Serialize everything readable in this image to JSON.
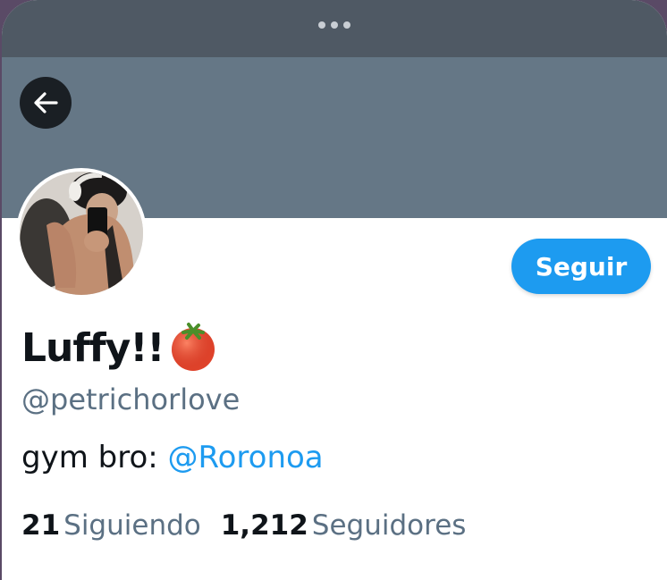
{
  "header": {
    "menu_icon": "more-dots-icon",
    "back_icon": "arrow-left-icon"
  },
  "colors": {
    "top_bar": "#4f5964",
    "banner": "#657786",
    "accent": "#1d9bf0",
    "text_primary": "#0f1419",
    "text_secondary": "#5b7083"
  },
  "profile": {
    "avatar_icon": "profile-photo",
    "follow_label": "Seguir",
    "name": "Luffy!!",
    "name_emoji": "tomato-icon",
    "handle": "@petrichorlove",
    "bio_prefix": "gym bro: ",
    "bio_mention": "@Roronoa",
    "following_count": "21",
    "following_label": "Siguiendo",
    "followers_count": "1,212",
    "followers_label": "Seguidores"
  }
}
